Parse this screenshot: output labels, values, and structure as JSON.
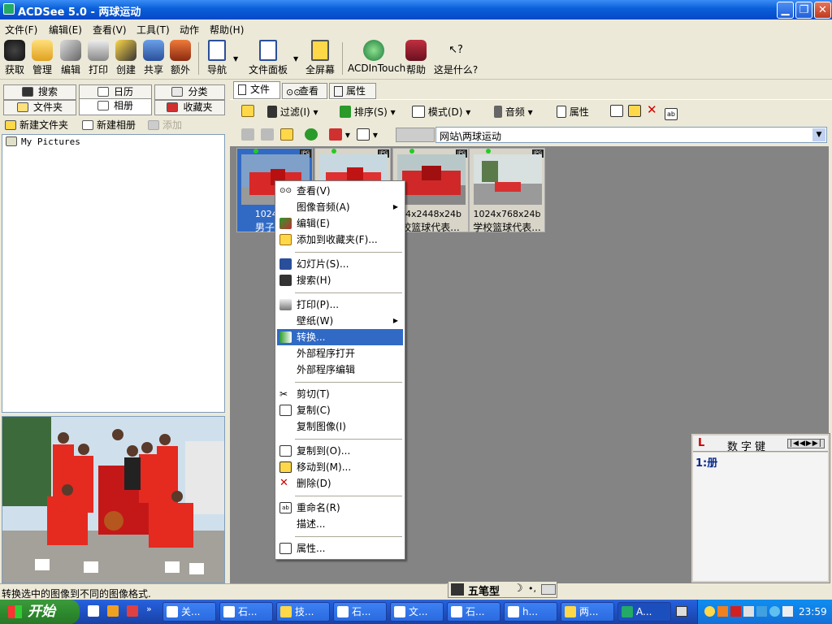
{
  "window": {
    "title": "ACDSee 5.0 - 两球运动",
    "min_icon": "minimize-icon",
    "max_icon": "restore-icon",
    "close_icon": "close-icon"
  },
  "menu": [
    "文件(F)",
    "编辑(E)",
    "查看(V)",
    "工具(T)",
    "动作",
    "帮助(H)"
  ],
  "toolbar": {
    "buttons": [
      "获取",
      "管理",
      "编辑",
      "打印",
      "创建",
      "共享",
      "额外"
    ],
    "nav": "导航",
    "file_panel": "文件面板",
    "fullscreen": "全屏幕",
    "acdintouch": "ACDInTouch",
    "help": "帮助",
    "whats_this": "这是什么?"
  },
  "left_tabs": {
    "row1": [
      "搜索",
      "日历",
      "分类"
    ],
    "row2": [
      "文件夹",
      "相册",
      "收藏夹"
    ],
    "actions": [
      "新建文件夹",
      "新建相册",
      "添加"
    ]
  },
  "tree": {
    "root": "My Pictures"
  },
  "right_tabs": [
    "文件",
    "查看",
    "属性"
  ],
  "right_toolbar": {
    "filter": "过滤(I)",
    "sort": "排序(S)",
    "mode": "模式(D)",
    "audio": "音频",
    "props": "属性"
  },
  "path": "网站\\两球运动",
  "thumbs": [
    {
      "dim": "1024x76",
      "name": "男子篮球",
      "selected": true,
      "format": "JPG"
    },
    {
      "dim": "",
      "name": "",
      "selected": false,
      "format": "JPG"
    },
    {
      "dim": "64x2448x24b",
      "name": "校篮球代表...",
      "selected": false,
      "format": "JPG"
    },
    {
      "dim": "1024x768x24b",
      "name": "学校篮球代表...",
      "selected": false,
      "format": "JPG"
    }
  ],
  "context_menu": [
    {
      "label": "查看(V)",
      "icon": "view-glasses-icon"
    },
    {
      "label": "图像音频(A)",
      "submenu": true
    },
    {
      "label": "编辑(E)",
      "icon": "edit-icon"
    },
    {
      "label": "添加到收藏夹(F)...",
      "icon": "favorites-icon"
    },
    {
      "label": "幻灯片(S)...",
      "icon": "slideshow-icon"
    },
    {
      "label": "搜索(H)",
      "icon": "binoculars-icon"
    },
    {
      "label": "打印(P)...",
      "icon": "printer-icon"
    },
    {
      "label": "壁纸(W)",
      "submenu": true
    },
    {
      "label": "转换...",
      "icon": "convert-icon",
      "highlighted": true
    },
    {
      "label": "外部程序打开"
    },
    {
      "label": "外部程序编辑"
    },
    {
      "label": "剪切(T)",
      "icon": "cut-icon"
    },
    {
      "label": "复制(C)",
      "icon": "copy-icon"
    },
    {
      "label": "复制图像(I)"
    },
    {
      "label": "复制到(O)...",
      "icon": "copy-to-icon"
    },
    {
      "label": "移动到(M)...",
      "icon": "move-to-icon"
    },
    {
      "label": "删除(D)",
      "icon": "delete-icon"
    },
    {
      "label": "重命名(R)",
      "icon": "rename-icon"
    },
    {
      "label": "描述..."
    },
    {
      "label": "属性...",
      "icon": "properties-icon"
    }
  ],
  "ime": {
    "title": "数字键",
    "entry": "1:册",
    "bar": "五笔型"
  },
  "status": "转换选中的图像到不同的图像格式.",
  "taskbar": {
    "start": "开始",
    "tasks": [
      "关...",
      "石...",
      "技...",
      "石...",
      "文...",
      "石...",
      "h...",
      "两...",
      "A..."
    ],
    "clock": "23:59"
  },
  "colors": {
    "title_blue": "#0a5fd8",
    "selection": "#316ac5",
    "grid_bg": "#848484",
    "start_green": "#2e8b2e"
  }
}
